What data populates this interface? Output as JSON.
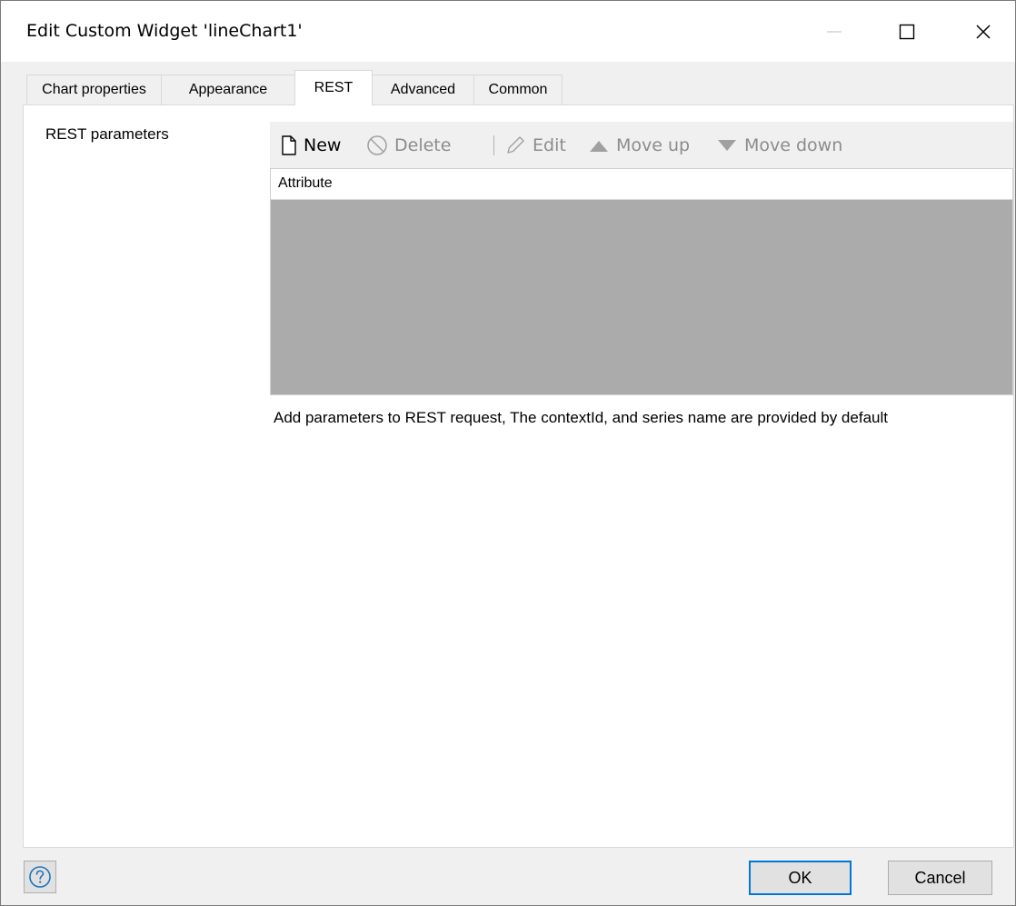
{
  "window": {
    "title": "Edit Custom Widget 'lineChart1'",
    "controls": {
      "minimize": "minimize-icon",
      "maximize": "maximize-icon",
      "close": "close-icon"
    }
  },
  "tabs": [
    {
      "label": "Chart properties",
      "active": false
    },
    {
      "label": "Appearance",
      "active": false
    },
    {
      "label": "REST",
      "active": true
    },
    {
      "label": "Advanced",
      "active": false
    },
    {
      "label": "Common",
      "active": false
    }
  ],
  "rest": {
    "section_label": "REST parameters",
    "toolbar": {
      "new": {
        "label": "New",
        "icon": "new-document-icon",
        "enabled": true
      },
      "delete": {
        "label": "Delete",
        "icon": "delete-icon",
        "enabled": false
      },
      "edit": {
        "label": "Edit",
        "icon": "pencil-icon",
        "enabled": false
      },
      "move_up": {
        "label": "Move up",
        "icon": "triangle-up-icon",
        "enabled": false
      },
      "move_down": {
        "label": "Move down",
        "icon": "triangle-down-icon",
        "enabled": false
      }
    },
    "grid": {
      "columns": [
        "Attribute"
      ],
      "rows": []
    },
    "help_text": "Add parameters to REST request, The contextId, and series name are provided by default"
  },
  "footer": {
    "help_icon": "help-icon",
    "ok_label": "OK",
    "cancel_label": "Cancel"
  },
  "colors": {
    "accent": "#0078d7",
    "grid_background": "#ababab",
    "disabled_text": "#8c8c8c"
  }
}
